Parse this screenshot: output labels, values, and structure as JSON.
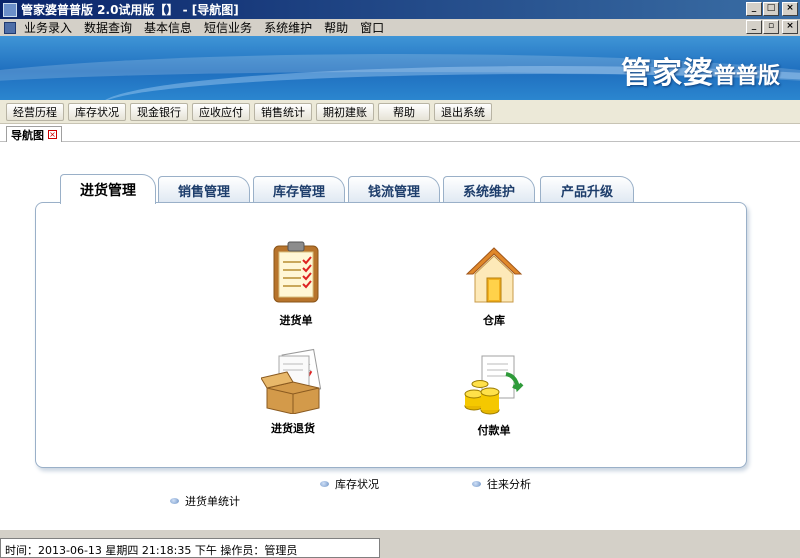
{
  "window": {
    "title": "管家婆普普版 2.0试用版【】 - [导航图]"
  },
  "menu": {
    "items": [
      "业务录入",
      "数据查询",
      "基本信息",
      "短信业务",
      "系统维护",
      "帮助",
      "窗口"
    ]
  },
  "banner": {
    "brand_main": "管家婆",
    "brand_sub": "普普版"
  },
  "toolbar": {
    "buttons": [
      "经营历程",
      "库存状况",
      "现金银行",
      "应收应付",
      "销售统计",
      "期初建账",
      "帮助",
      "退出系统"
    ]
  },
  "page_tab": {
    "label": "导航图"
  },
  "module_tabs": [
    "进货管理",
    "销售管理",
    "库存管理",
    "钱流管理",
    "系统维护",
    "产品升级"
  ],
  "active_tab": 0,
  "panel_items": [
    {
      "label": "进货单",
      "icon": "clipboard-icon"
    },
    {
      "label": "仓库",
      "icon": "warehouse-icon"
    },
    {
      "label": "进货退货",
      "icon": "return-box-icon"
    },
    {
      "label": "付款单",
      "icon": "payment-coins-icon"
    }
  ],
  "links": [
    {
      "label": "库存状况"
    },
    {
      "label": "往来分析"
    },
    {
      "label": "进货单统计"
    }
  ],
  "statusbar": {
    "text": "时间：2013-06-13 星期四 21:18:35 下午    操作员：管理员"
  },
  "colors": {
    "titlebar_start": "#0a246a",
    "banner": "#1f6fbf",
    "tab_text": "#1d3d6b"
  }
}
